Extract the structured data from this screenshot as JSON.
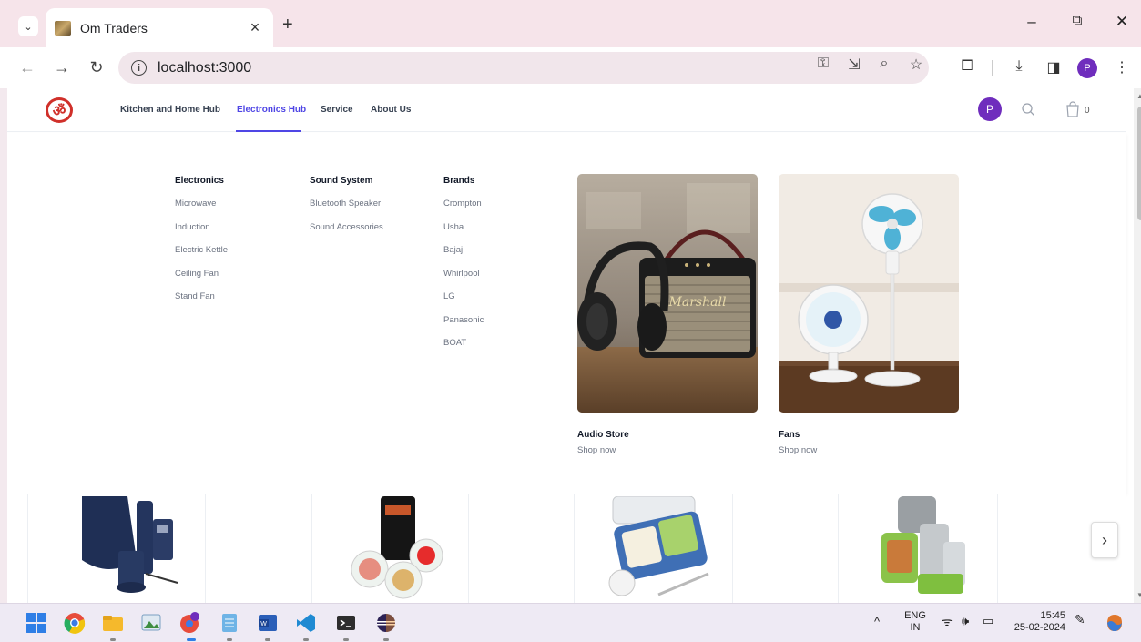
{
  "browser": {
    "tab_title": "Om Traders",
    "url": "localhost:3000",
    "profile_initial": "P"
  },
  "site": {
    "nav": [
      "Kitchen and Home Hub",
      "Electronics Hub",
      "Service",
      "About Us"
    ],
    "active_nav": "Electronics Hub",
    "avatar_initial": "P",
    "cart_count": "0"
  },
  "flyout": {
    "columns": [
      {
        "heading": "Electronics",
        "items": [
          "Microwave",
          "Induction",
          "Electric Kettle",
          "Ceiling Fan",
          "Stand Fan"
        ]
      },
      {
        "heading": "Sound System",
        "items": [
          "Bluetooth Speaker",
          "Sound Accessories"
        ]
      },
      {
        "heading": "Brands",
        "items": [
          "Crompton",
          "Usha",
          "Bajaj",
          "Whirlpool",
          "LG",
          "Panasonic",
          "BOAT"
        ]
      }
    ],
    "features": [
      {
        "title": "Audio Store",
        "cta": "Shop now",
        "speaker_brand": "Marshall"
      },
      {
        "title": "Fans",
        "cta": "Shop now"
      }
    ]
  },
  "taskbar": {
    "lang_top": "ENG",
    "lang_bottom": "IN",
    "time": "15:45",
    "date": "25-02-2024"
  },
  "colors": {
    "accent": "#4f46e5",
    "avatar": "#6f2dbd",
    "logo": "#d0302a"
  }
}
